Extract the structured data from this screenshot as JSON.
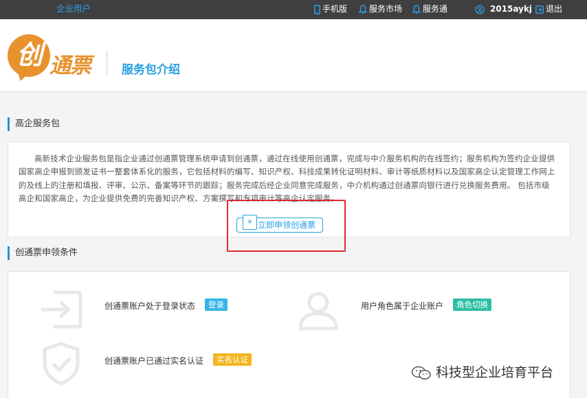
{
  "topbar": {
    "enterprise_user": "企业用户",
    "mobile": "手机版",
    "service_market": "服务市场",
    "service_pass": "服务通",
    "username": "2015aykj",
    "logout": "退出"
  },
  "header": {
    "logo_char": "创",
    "logo_rest": "通票",
    "title": "服务包介绍"
  },
  "section1": {
    "title": "高企服务包",
    "description": "高新技术企业服务包是指企业通过创通票管理系统申请到创通票，通过在线使用创通票，完成与中介服务机构的在线签约；服务机构为签约企业提供国家高企申报到颁发证书一整套体系化的服务，它包括材料的编写、知识产权、科技成果转化证明材料、审计等纸质材料以及国家高企认定管理工作网上的及线上的注册和填报、评审、公示、备案等环节的跟踪；服务完成后经企业同意完成服务，中介机构通过创通票向银行进行兑换服务费用。 包括市级高企和国家高企，为企业提供免费的完善知识产权、方案撰写和专项审计等高企认定服务。",
    "apply_button": "立即申领创通票",
    "ticket_symbol": "¥"
  },
  "section2": {
    "title": "创通票申领条件",
    "conditions": [
      {
        "label": "创通票账户处于登录状态",
        "action": "登录"
      },
      {
        "label": "用户角色属于企业账户",
        "action": "角色切换"
      },
      {
        "label": "创通票账户已通过实名认证",
        "action": "实名认证"
      }
    ]
  },
  "watermark": "科技型企业培育平台",
  "colors": {
    "topbar_bg": "#3f3f3f",
    "accent_blue": "#27a0e1",
    "logo_orange": "#e8922e",
    "highlight_red": "#e0282e",
    "badge_blue": "#34b5ea",
    "badge_teal": "#2cbfa2",
    "badge_yellow": "#f2b51c"
  }
}
